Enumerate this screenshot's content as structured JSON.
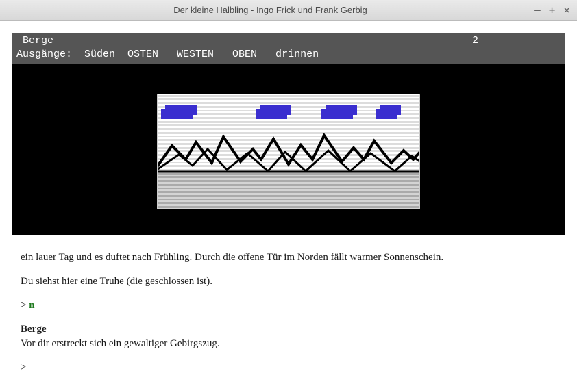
{
  "window": {
    "title": "Der kleine Halbling - Ingo Frick und Frank Gerbig",
    "min": "–",
    "max": "+",
    "close": "×"
  },
  "status": {
    "location": " Berge",
    "score": "2",
    "exits_label": "Ausgänge:  Süden  OSTEN   WESTEN   OBEN   drinnen"
  },
  "transcript": {
    "para1": "ein lauer Tag und es duftet nach Frühling. Durch die offene Tür im Norden fällt warmer Sonnenschein.",
    "para2": "Du siehst hier eine Truhe (die geschlossen ist).",
    "prompt1_prefix": "> ",
    "prompt1_cmd": "n",
    "loc_name": "Berge",
    "loc_desc": "Vor dir erstreckt sich ein gewaltiger Gebirgszug.",
    "prompt2": ">"
  }
}
